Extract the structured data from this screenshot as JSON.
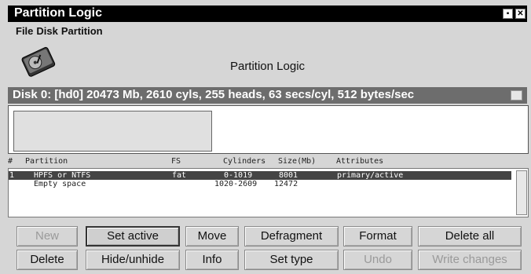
{
  "window": {
    "title": "Partition Logic"
  },
  "menu": [
    "File",
    "Disk",
    "Partition"
  ],
  "app": {
    "title": "Partition Logic"
  },
  "disk": {
    "info": "Disk 0: [hd0] 20473 Mb, 2610 cyls, 255 heads, 63 secs/cyl, 512 bytes/sec"
  },
  "table": {
    "headers": {
      "num": "#",
      "partition": "Partition",
      "fs": "FS",
      "cylinders": "Cylinders",
      "size": "Size(Mb)",
      "attributes": "Attributes"
    },
    "rows": [
      {
        "num": "1",
        "partition": "HPFS or NTFS",
        "fs": "fat",
        "cylinders": "0-1019",
        "size": "8001",
        "attributes": "primary/active"
      },
      {
        "num": "",
        "partition": "Empty space",
        "fs": "",
        "cylinders": "1020-2609",
        "size": "12472",
        "attributes": ""
      }
    ]
  },
  "buttons": {
    "new": "New",
    "set_active": "Set active",
    "move": "Move",
    "defragment": "Defragment",
    "format": "Format",
    "delete_all": "Delete all",
    "delete": "Delete",
    "hide_unhide": "Hide/unhide",
    "info": "Info",
    "set_type": "Set type",
    "undo": "Undo",
    "write_changes": "Write changes"
  }
}
